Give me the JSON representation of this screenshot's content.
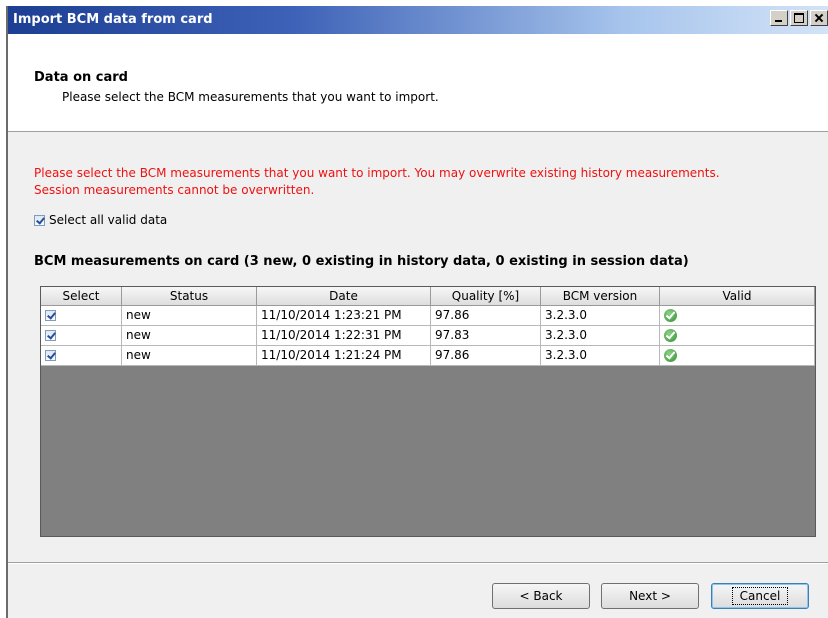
{
  "window": {
    "title": "Import BCM data from card"
  },
  "header": {
    "title": "Data on card",
    "subtitle": "Please select the BCM measurements that you want to import."
  },
  "warning": {
    "line1": "Please select the BCM measurements that you want to import. You may overwrite existing history measurements.",
    "line2": "Session measurements cannot be overwritten."
  },
  "select_all": {
    "label": "Select all valid data",
    "checked": true
  },
  "section_title": "BCM measurements on card (3 new, 0 existing in history data, 0 existing in session data)",
  "table": {
    "columns": [
      "Select",
      "Status",
      "Date",
      "Quality [%]",
      "BCM version",
      "Valid"
    ],
    "rows": [
      {
        "selected": true,
        "status": "new",
        "date": "11/10/2014 1:23:21 PM",
        "quality": "97.86",
        "version": "3.2.3.0",
        "valid": "valid-check-icon"
      },
      {
        "selected": true,
        "status": "new",
        "date": "11/10/2014 1:22:31 PM",
        "quality": "97.83",
        "version": "3.2.3.0",
        "valid": "valid-check-icon"
      },
      {
        "selected": true,
        "status": "new",
        "date": "11/10/2014 1:21:24 PM",
        "quality": "97.86",
        "version": "3.2.3.0",
        "valid": "valid-check-icon"
      }
    ]
  },
  "buttons": {
    "back": "< Back",
    "next": "Next >",
    "cancel": "Cancel"
  },
  "colors": {
    "warning_text": "#ee1111",
    "valid_icon": "#2f8f2b",
    "grid_background": "#808080"
  }
}
